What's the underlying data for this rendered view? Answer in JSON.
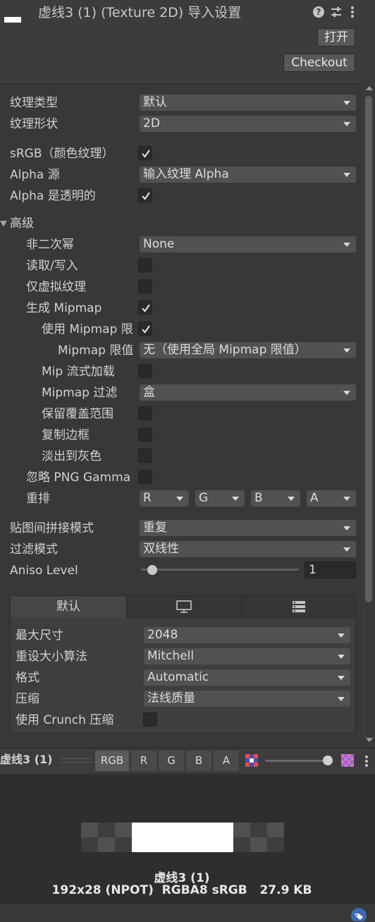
{
  "header": {
    "title": "虚线3 (1) (Texture 2D) 导入设置",
    "open_label": "打开",
    "checkout_label": "Checkout",
    "help_icon": "help-icon",
    "settings_icon": "sliders-icon",
    "menu_icon": "more-vert-icon"
  },
  "fields": {
    "texture_type": {
      "label": "纹理类型",
      "value": "默认"
    },
    "texture_shape": {
      "label": "纹理形状",
      "value": "2D"
    },
    "srgb": {
      "label": "sRGB（颜色纹理）",
      "checked": true
    },
    "alpha_source": {
      "label": "Alpha 源",
      "value": "输入纹理 Alpha"
    },
    "alpha_transparent": {
      "label": "Alpha 是透明的",
      "checked": true
    }
  },
  "advanced": {
    "header": "高级",
    "npot": {
      "label": "非二次幂",
      "value": "None"
    },
    "read_write": {
      "label": "读取/写入",
      "checked": false
    },
    "virtual_texture": {
      "label": "仅虚拟纹理",
      "checked": false
    },
    "gen_mipmap": {
      "label": "生成 Mipmap",
      "checked": true
    },
    "use_mipmap_limit": {
      "label": "使用 Mipmap 限",
      "checked": true
    },
    "mipmap_limit": {
      "label": "Mipmap 限值",
      "value": "无（使用全局 Mipmap 限值）"
    },
    "mip_streaming": {
      "label": "Mip 流式加载",
      "checked": false
    },
    "mipmap_filter": {
      "label": "Mipmap 过滤",
      "value": "盒"
    },
    "preserve_coverage": {
      "label": "保留覆盖范围",
      "checked": false
    },
    "border_mip": {
      "label": "复制边框",
      "checked": false
    },
    "fadeout": {
      "label": "淡出到灰色",
      "checked": false
    },
    "ignore_png_gamma": {
      "label": "忽略 PNG Gamma",
      "checked": false
    },
    "swizzle": {
      "label": "重排",
      "values": [
        "R",
        "G",
        "B",
        "A"
      ]
    }
  },
  "wrap": {
    "wrap_mode": {
      "label": "贴图间拼接模式",
      "value": "重复"
    },
    "filter_mode": {
      "label": "过滤模式",
      "value": "双线性"
    },
    "aniso": {
      "label": "Aniso Level",
      "value": "1",
      "slider_fraction": 0.0
    }
  },
  "platform": {
    "tabs": [
      {
        "label": "默认",
        "icon": ""
      },
      {
        "label": "",
        "icon": "monitor-icon"
      },
      {
        "label": "",
        "icon": "server-icon"
      }
    ],
    "max_size": {
      "label": "最大尺寸",
      "value": "2048"
    },
    "resize": {
      "label": "重设大小算法",
      "value": "Mitchell"
    },
    "format": {
      "label": "格式",
      "value": "Automatic"
    },
    "compression": {
      "label": "压缩",
      "value": "法线质量"
    },
    "crunch": {
      "label": "使用 Crunch 压缩",
      "checked": false
    }
  },
  "preview": {
    "toolbar_title": "虚线3 (1)",
    "channels": [
      "RGB",
      "R",
      "G",
      "B",
      "A"
    ],
    "mip_slider_fraction": 1.0,
    "name": "虚线3 (1)",
    "info": "192x28 (NPOT)  RGBA8 sRGB   27.9 KB"
  },
  "colors": {
    "panel_bg": "#383838",
    "header_bg": "#3c3c3c",
    "dropdown_bg": "#515151",
    "checkbox_bg": "#2a2a2a",
    "preview_bg": "#2e2e2e"
  }
}
